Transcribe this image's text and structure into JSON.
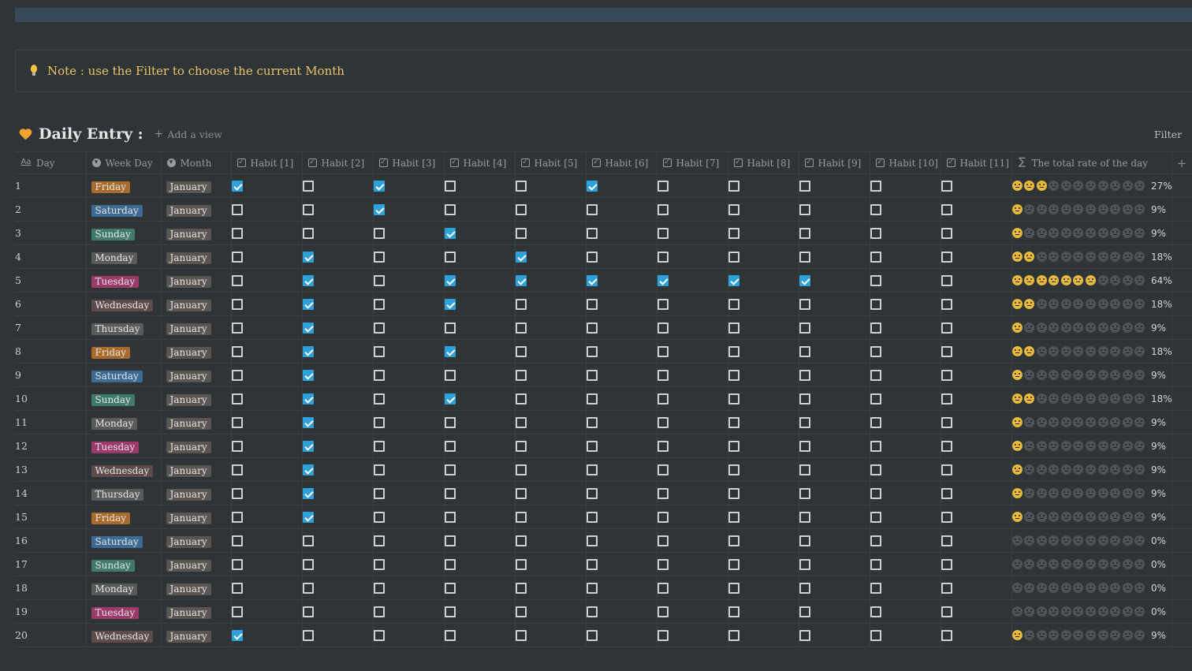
{
  "callout": {
    "icon": "lightbulb-icon",
    "text": "Note : use the Filter to choose the current Month"
  },
  "database": {
    "icon": "orange-heart-icon",
    "title": "Daily Entry :",
    "add_view": "Add a view",
    "filter": "Filter"
  },
  "columns": {
    "day": "Day",
    "week_day": "Week Day",
    "month": "Month",
    "habits": [
      "Habit [1]",
      "Habit [2]",
      "Habit [3]",
      "Habit [4]",
      "Habit [5]",
      "Habit [6]",
      "Habit [7]",
      "Habit [8]",
      "Habit [9]",
      "Habit [10]",
      "Habit [11]"
    ],
    "rate": "The total rate of the day",
    "add": "+"
  },
  "tag_colors": {
    "Monday": "#5a5a5a",
    "Tuesday": "#9b3a6b",
    "Wednesday": "#5e4b4b",
    "Thursday": "#5b5b5b",
    "Friday": "#a86b2e",
    "Saturday": "#3d6a93",
    "Sunday": "#3f7a6a",
    "January": "#5a5552"
  },
  "rows": [
    {
      "day": "1",
      "week_day": "Friday",
      "month": "January",
      "habits": [
        1,
        0,
        1,
        0,
        0,
        1,
        0,
        0,
        0,
        0,
        0
      ],
      "rate": "27%"
    },
    {
      "day": "2",
      "week_day": "Saturday",
      "month": "January",
      "habits": [
        0,
        0,
        1,
        0,
        0,
        0,
        0,
        0,
        0,
        0,
        0
      ],
      "rate": "9%"
    },
    {
      "day": "3",
      "week_day": "Sunday",
      "month": "January",
      "habits": [
        0,
        0,
        0,
        1,
        0,
        0,
        0,
        0,
        0,
        0,
        0
      ],
      "rate": "9%"
    },
    {
      "day": "4",
      "week_day": "Monday",
      "month": "January",
      "habits": [
        0,
        1,
        0,
        0,
        1,
        0,
        0,
        0,
        0,
        0,
        0
      ],
      "rate": "18%"
    },
    {
      "day": "5",
      "week_day": "Tuesday",
      "month": "January",
      "habits": [
        0,
        1,
        0,
        1,
        1,
        1,
        1,
        1,
        1,
        0,
        0
      ],
      "rate": "64%"
    },
    {
      "day": "6",
      "week_day": "Wednesday",
      "month": "January",
      "habits": [
        0,
        1,
        0,
        1,
        0,
        0,
        0,
        0,
        0,
        0,
        0
      ],
      "rate": "18%"
    },
    {
      "day": "7",
      "week_day": "Thursday",
      "month": "January",
      "habits": [
        0,
        1,
        0,
        0,
        0,
        0,
        0,
        0,
        0,
        0,
        0
      ],
      "rate": "9%"
    },
    {
      "day": "8",
      "week_day": "Friday",
      "month": "January",
      "habits": [
        0,
        1,
        0,
        1,
        0,
        0,
        0,
        0,
        0,
        0,
        0
      ],
      "rate": "18%"
    },
    {
      "day": "9",
      "week_day": "Saturday",
      "month": "January",
      "habits": [
        0,
        1,
        0,
        0,
        0,
        0,
        0,
        0,
        0,
        0,
        0
      ],
      "rate": "9%"
    },
    {
      "day": "10",
      "week_day": "Sunday",
      "month": "January",
      "habits": [
        0,
        1,
        0,
        1,
        0,
        0,
        0,
        0,
        0,
        0,
        0
      ],
      "rate": "18%"
    },
    {
      "day": "11",
      "week_day": "Monday",
      "month": "January",
      "habits": [
        0,
        1,
        0,
        0,
        0,
        0,
        0,
        0,
        0,
        0,
        0
      ],
      "rate": "9%"
    },
    {
      "day": "12",
      "week_day": "Tuesday",
      "month": "January",
      "habits": [
        0,
        1,
        0,
        0,
        0,
        0,
        0,
        0,
        0,
        0,
        0
      ],
      "rate": "9%"
    },
    {
      "day": "13",
      "week_day": "Wednesday",
      "month": "January",
      "habits": [
        0,
        1,
        0,
        0,
        0,
        0,
        0,
        0,
        0,
        0,
        0
      ],
      "rate": "9%"
    },
    {
      "day": "14",
      "week_day": "Thursday",
      "month": "January",
      "habits": [
        0,
        1,
        0,
        0,
        0,
        0,
        0,
        0,
        0,
        0,
        0
      ],
      "rate": "9%"
    },
    {
      "day": "15",
      "week_day": "Friday",
      "month": "January",
      "habits": [
        0,
        1,
        0,
        0,
        0,
        0,
        0,
        0,
        0,
        0,
        0
      ],
      "rate": "9%"
    },
    {
      "day": "16",
      "week_day": "Saturday",
      "month": "January",
      "habits": [
        0,
        0,
        0,
        0,
        0,
        0,
        0,
        0,
        0,
        0,
        0
      ],
      "rate": "0%"
    },
    {
      "day": "17",
      "week_day": "Sunday",
      "month": "January",
      "habits": [
        0,
        0,
        0,
        0,
        0,
        0,
        0,
        0,
        0,
        0,
        0
      ],
      "rate": "0%"
    },
    {
      "day": "18",
      "week_day": "Monday",
      "month": "January",
      "habits": [
        0,
        0,
        0,
        0,
        0,
        0,
        0,
        0,
        0,
        0,
        0
      ],
      "rate": "0%"
    },
    {
      "day": "19",
      "week_day": "Tuesday",
      "month": "January",
      "habits": [
        0,
        0,
        0,
        0,
        0,
        0,
        0,
        0,
        0,
        0,
        0
      ],
      "rate": "0%"
    },
    {
      "day": "20",
      "week_day": "Wednesday",
      "month": "January",
      "habits": [
        1,
        0,
        0,
        0,
        0,
        0,
        0,
        0,
        0,
        0,
        0
      ],
      "rate": "9%"
    }
  ]
}
